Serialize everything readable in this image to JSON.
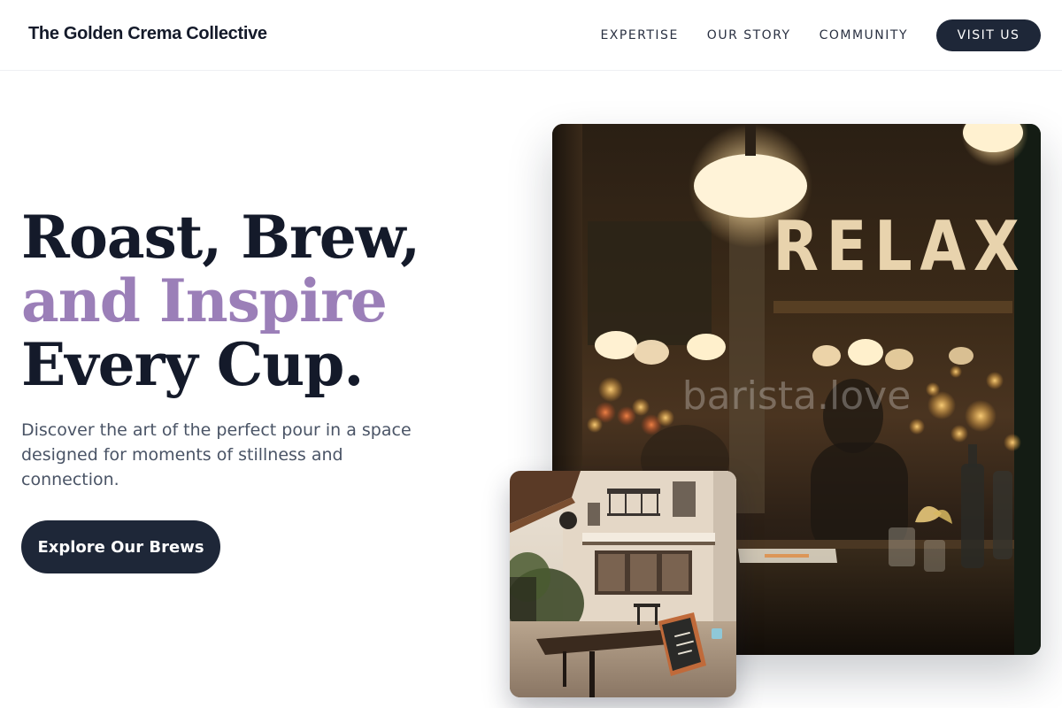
{
  "brand": {
    "name": "The Golden Crema Collective"
  },
  "nav": {
    "links": [
      {
        "label": "EXPERTISE"
      },
      {
        "label": "OUR STORY"
      },
      {
        "label": "COMMUNITY"
      }
    ],
    "cta_label": "VISIT US"
  },
  "hero": {
    "title_line1": "Roast, Brew,",
    "title_line2": "and Inspire",
    "title_line3": "Every Cup.",
    "subtitle": "Discover the art of the perfect pour in a space designed for moments of stillness and connection.",
    "cta_label": "Explore Our Brews"
  },
  "images": {
    "main": {
      "sign_text": "RELAX",
      "watermark": "barista.love"
    }
  },
  "colors": {
    "primary_dark": "#1e2738",
    "accent_purple": "#9b7fb8",
    "body_text": "#4a5466"
  }
}
